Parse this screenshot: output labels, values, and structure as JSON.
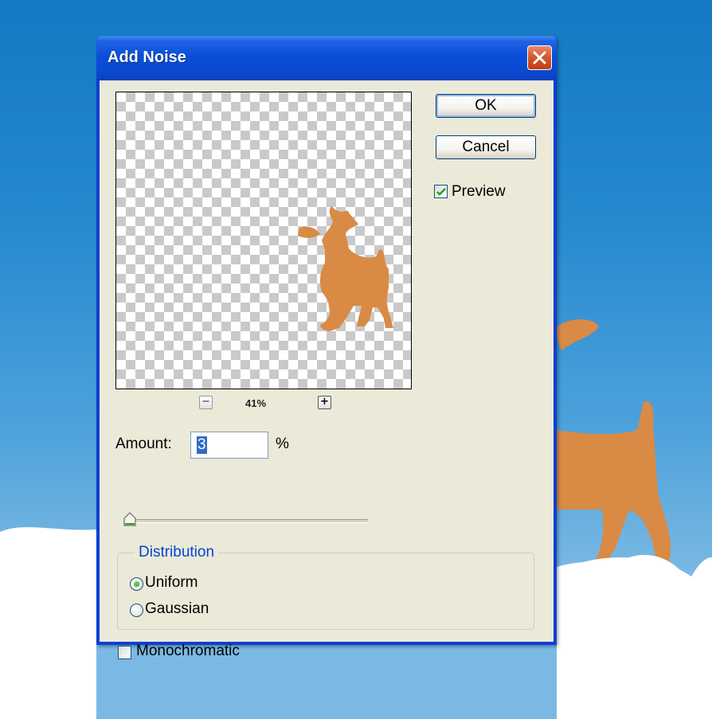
{
  "dialog": {
    "title": "Add Noise",
    "close_icon": "close-x-icon"
  },
  "preview": {
    "zoom_level": "41%",
    "zoom_out_icon": "minus-icon",
    "zoom_in_icon": "plus-icon"
  },
  "buttons": {
    "ok_label": "OK",
    "cancel_label": "Cancel"
  },
  "preview_option": {
    "label": "Preview",
    "checked": true
  },
  "amount": {
    "label": "Amount:",
    "value": "3",
    "unit": "%"
  },
  "distribution": {
    "title": "Distribution",
    "options": [
      {
        "label": "Uniform",
        "selected": true
      },
      {
        "label": "Gaussian",
        "selected": false
      }
    ]
  },
  "monochromatic": {
    "label": "Monochromatic",
    "checked": false
  },
  "colors": {
    "titlebar": "#0a49d0",
    "dialog_face": "#ebe9d8",
    "deer": "#d98a45",
    "group_title": "#0046d5",
    "selection": "#316ac5"
  }
}
